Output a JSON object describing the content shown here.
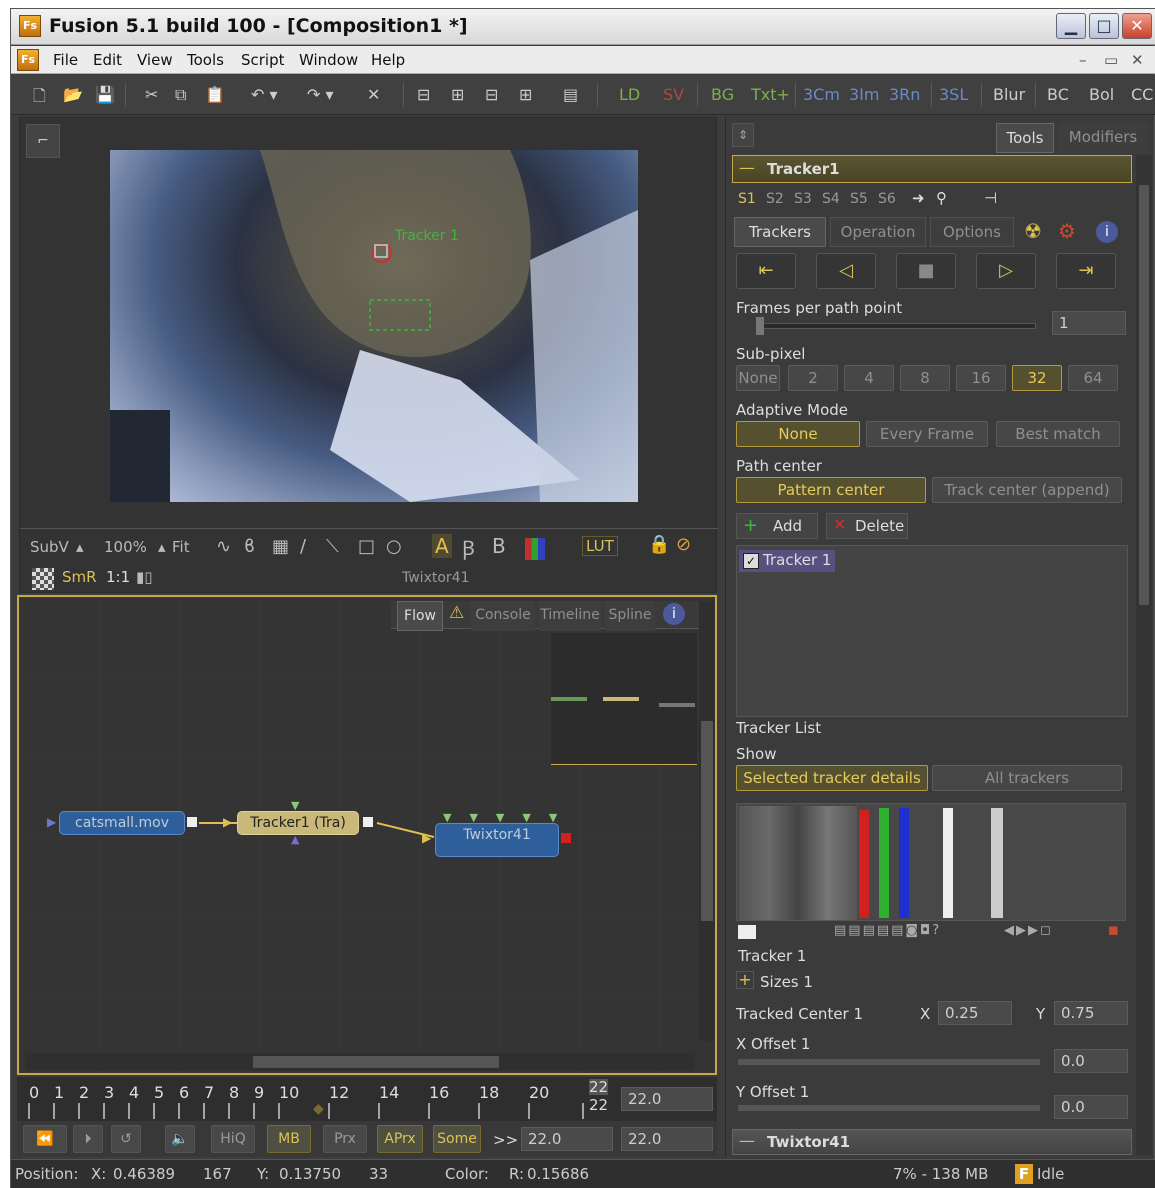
{
  "window": {
    "title": "Fusion 5.1 build 100 - [Composition1 *]",
    "app_icon": "Fs"
  },
  "menu": [
    "File",
    "Edit",
    "View",
    "Tools",
    "Script",
    "Window",
    "Help"
  ],
  "toolbar": {
    "tools": [
      "LD",
      "SV",
      "BG",
      "Txt+",
      "3Cm",
      "3Im",
      "3Rn",
      "3SL",
      "Blur",
      "BC",
      "Bol",
      "CC"
    ]
  },
  "viewer": {
    "view_select": "SubV",
    "zoom": "100%",
    "fit": "Fit",
    "sub_labels": [
      "A",
      "B"
    ],
    "lut": "LUT",
    "smr": "SmR",
    "ratio": "1:1",
    "name": "Twixtor41",
    "tracker_overlay": "Tracker 1"
  },
  "flow_tabs": [
    "Flow",
    "Console",
    "Timeline",
    "Spline"
  ],
  "nodes": {
    "catsmall": "catsmall.mov",
    "tracker": "Tracker1  (Tra)",
    "twixtor": "Twixtor41"
  },
  "timeline": {
    "ticks": [
      "0",
      "1",
      "2",
      "3",
      "4",
      "5",
      "6",
      "7",
      "8",
      "9",
      "10",
      "12",
      "14",
      "16",
      "18",
      "20"
    ],
    "end_top": "22",
    "end_bottom": "22",
    "end_value": "22.0"
  },
  "playback": {
    "buttons": [
      "HiQ",
      "MB",
      "Prx",
      "APrx",
      "Some"
    ],
    "arrows": ">>",
    "current": "22.0",
    "end": "22.0"
  },
  "status": {
    "position_label": "Position:",
    "x_label": "X:",
    "x": "0.46389",
    "px": "167",
    "y_label": "Y:",
    "y": "0.13750",
    "py": "33",
    "color_label": "Color:",
    "r_label": "R:",
    "r": "0.15686",
    "memory": "7% - 138 MB",
    "state": "Idle",
    "state_icon": "F"
  },
  "right": {
    "tabs": [
      "Tools",
      "Modifiers"
    ],
    "tracker_header": "Tracker1",
    "stabilize": [
      "S1",
      "S2",
      "S3",
      "S4",
      "S5",
      "S6"
    ],
    "sub_tabs": [
      "Trackers",
      "Operation",
      "Options"
    ],
    "frames_per_path_label": "Frames per path point",
    "frames_per_path": "1",
    "subpixel_label": "Sub-pixel",
    "subpixel": [
      "None",
      "2",
      "4",
      "8",
      "16",
      "32",
      "64"
    ],
    "subpixel_selected": "32",
    "adaptive_label": "Adaptive Mode",
    "adaptive": [
      "None",
      "Every Frame",
      "Best match"
    ],
    "adaptive_selected": "None",
    "path_center_label": "Path center",
    "path_center": [
      "Pattern center",
      "Track center (append)"
    ],
    "path_center_selected": "Pattern center",
    "add": "Add",
    "delete": "Delete",
    "tracker_item": "Tracker 1",
    "tracker_list_label": "Tracker List",
    "show_label": "Show",
    "show": [
      "Selected tracker details",
      "All trackers"
    ],
    "show_selected": "Selected tracker details",
    "tracker_name": "Tracker 1",
    "sizes_label": "Sizes 1",
    "tracked_center_label": "Tracked Center 1",
    "tc_x_label": "X",
    "tc_x": "0.25",
    "tc_y_label": "Y",
    "tc_y": "0.75",
    "xoffset_label": "X Offset 1",
    "xoffset": "0.0",
    "yoffset_label": "Y Offset 1",
    "yoffset": "0.0",
    "twixtor_header": "Twixtor41"
  },
  "colors": {
    "accent": "#d8c25a",
    "node_blue": "#2e5f9a",
    "tracker_node": "#c9b878",
    "flow_border": "#c8a94a"
  }
}
